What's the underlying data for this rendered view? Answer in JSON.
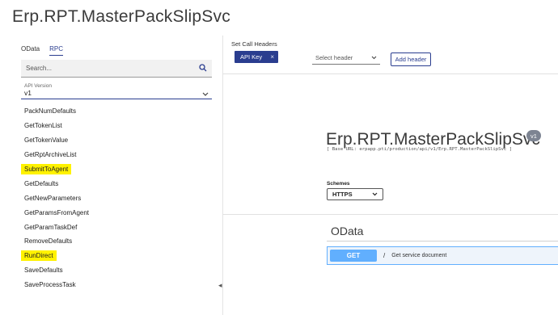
{
  "page": {
    "title": "Erp.RPT.MasterPackSlipSvc"
  },
  "sidebar": {
    "tabs": [
      {
        "label": "OData",
        "active": false
      },
      {
        "label": "RPC",
        "active": true
      }
    ],
    "search": {
      "placeholder": "Search...",
      "icon": "search-icon"
    },
    "api_version": {
      "label": "API Version",
      "value": "v1"
    },
    "operations": [
      {
        "label": "PackNumDefaults",
        "highlighted": false
      },
      {
        "label": "GetTokenList",
        "highlighted": false
      },
      {
        "label": "GetTokenValue",
        "highlighted": false
      },
      {
        "label": "GetRptArchiveList",
        "highlighted": false
      },
      {
        "label": "SubmitToAgent",
        "highlighted": true
      },
      {
        "label": "GetDefaults",
        "highlighted": false
      },
      {
        "label": "GetNewParameters",
        "highlighted": false
      },
      {
        "label": "GetParamsFromAgent",
        "highlighted": false
      },
      {
        "label": "GetParamTaskDef",
        "highlighted": false
      },
      {
        "label": "RemoveDefaults",
        "highlighted": false
      },
      {
        "label": "RunDirect",
        "highlighted": true
      },
      {
        "label": "SaveDefaults",
        "highlighted": false
      },
      {
        "label": "SaveProcessTask",
        "highlighted": false
      }
    ]
  },
  "headers": {
    "label": "Set Call Headers",
    "chip_label": "API Key",
    "chip_close": "×",
    "select_placeholder": "Select header",
    "add_button": "Add header"
  },
  "service": {
    "title": "Erp.RPT.MasterPackSlipSvc",
    "version": "v1",
    "base_url": "[ Base URL: erpapp.pti/production/api/v1/Erp.RPT.MasterPackSlipSvc ]",
    "schemes_label": "Schemes",
    "scheme_value": "HTTPS"
  },
  "section": {
    "title": "OData",
    "operation": {
      "method": "GET",
      "path": "/",
      "summary": "Get service document"
    }
  },
  "colors": {
    "accent": "#2a3d8f",
    "highlight": "#fff200",
    "get_method": "#61affe",
    "version_badge": "#7d8492"
  }
}
